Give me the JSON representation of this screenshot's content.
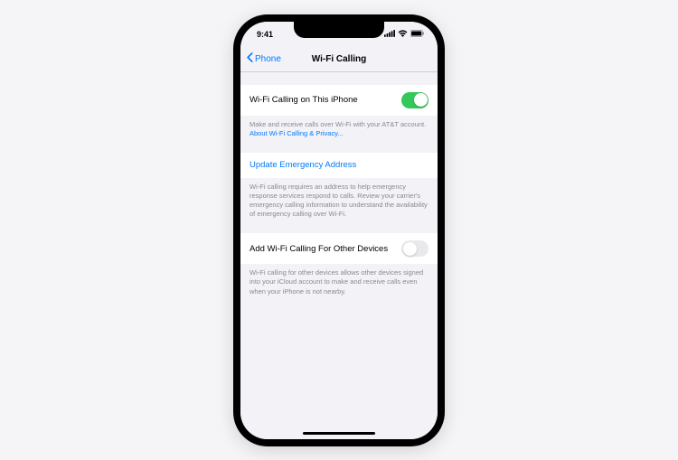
{
  "statusbar": {
    "time": "9:41"
  },
  "nav": {
    "back_label": "Phone",
    "title": "Wi-Fi Calling"
  },
  "section1": {
    "row_label": "Wi-Fi Calling on This iPhone",
    "footer_text": "Make and receive calls over Wi-Fi with your AT&T account.",
    "footer_link": "About Wi-Fi Calling & Privacy..."
  },
  "section2": {
    "row_label": "Update Emergency Address",
    "footer_text": "Wi-Fi calling requires an address to help emergency response services respond to calls. Review your carrier's emergency calling information to understand the availability of emergency calling over Wi-Fi."
  },
  "section3": {
    "row_label": "Add Wi-Fi Calling For Other Devices",
    "footer_text": "Wi-Fi calling for other devices allows other devices signed into your iCloud account to make and receive calls even when your iPhone is not nearby."
  }
}
